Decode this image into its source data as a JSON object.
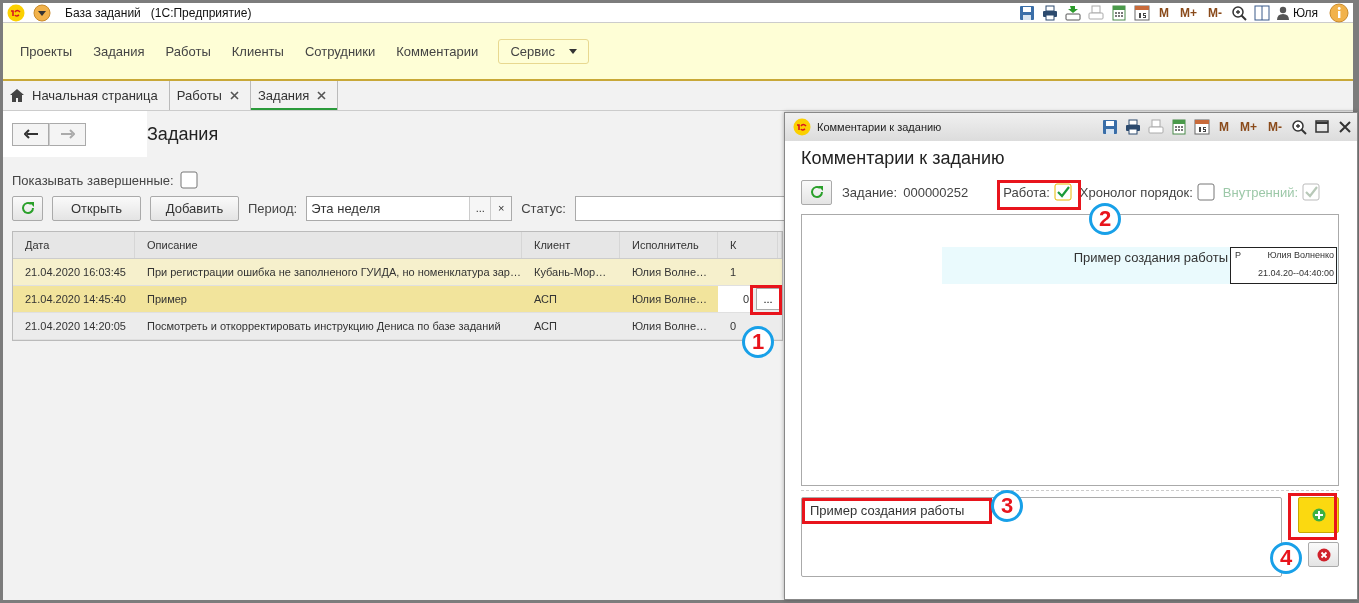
{
  "window": {
    "title": "База заданий",
    "subtitle": "(1С:Предприятие)",
    "memory_buttons": [
      "M",
      "M+",
      "M-"
    ],
    "user": "Юля"
  },
  "menu": {
    "items": [
      "Проекты",
      "Задания",
      "Работы",
      "Клиенты",
      "Сотрудники",
      "Комментарии"
    ],
    "service_button": "Сервис"
  },
  "tabs": [
    {
      "label": "Начальная страница",
      "selected": false,
      "closable": false,
      "kind": "home"
    },
    {
      "label": "Работы",
      "selected": false,
      "closable": true,
      "kind": "plain"
    },
    {
      "label": "Задания",
      "selected": true,
      "closable": true,
      "kind": "plain"
    }
  ],
  "page": {
    "title": "Задания",
    "show_completed": {
      "label": "Показывать завершенные:",
      "checked": false
    },
    "buttons": [
      "Открыть",
      "Добавить"
    ],
    "period_label": "Период:",
    "period_value": "Эта неделя",
    "period_choose": "...",
    "period_clear": "×",
    "status_label": "Статус:"
  },
  "table": {
    "columns": [
      "Дата",
      "Описание",
      "Клиент",
      "Исполнитель",
      "К"
    ],
    "rows": [
      {
        "cells": [
          "21.04.2020 16:03:45",
          "При регистрации ошибка не заполненого ГУИДА, но номенклатура зар…",
          "Кубань-Мор…",
          "Юлия Волне…",
          "1"
        ],
        "selected": false,
        "highlighted": true
      },
      {
        "cells": [
          "21.04.2020 14:45:40",
          "Пример",
          "АСП",
          "Юлия Волне…",
          "0"
        ],
        "selected": true,
        "highlighted": false,
        "cell_button": "..."
      },
      {
        "cells": [
          "21.04.2020 14:20:05",
          "Посмотреть и откорректировать инструкцию Дениса по базе заданий",
          "АСП",
          "Юлия Волне…",
          "0"
        ],
        "selected": false,
        "highlighted": false
      }
    ]
  },
  "dialog": {
    "title": "Комментарии к заданию",
    "memory_buttons": [
      "M",
      "M+",
      "M-"
    ],
    "heading": "Комментарии к заданию",
    "task_label": "Задание:",
    "task_number": "000000252",
    "checkboxes": [
      {
        "label": "Работа:",
        "checked": true,
        "disabled": false
      },
      {
        "label": "Хронолог порядок:",
        "checked": false,
        "disabled": false
      },
      {
        "label": "Внутренний:",
        "checked": true,
        "disabled": true
      }
    ],
    "comments": [
      {
        "text": "Пример создания работы",
        "mark": "Р",
        "author": "Юлия Волненко",
        "time": "21.04.20--04:40:00"
      }
    ],
    "input_value": "Пример создания работы"
  },
  "annotations": [
    {
      "number": "1"
    },
    {
      "number": "2"
    },
    {
      "number": "3"
    },
    {
      "number": "4"
    }
  ]
}
